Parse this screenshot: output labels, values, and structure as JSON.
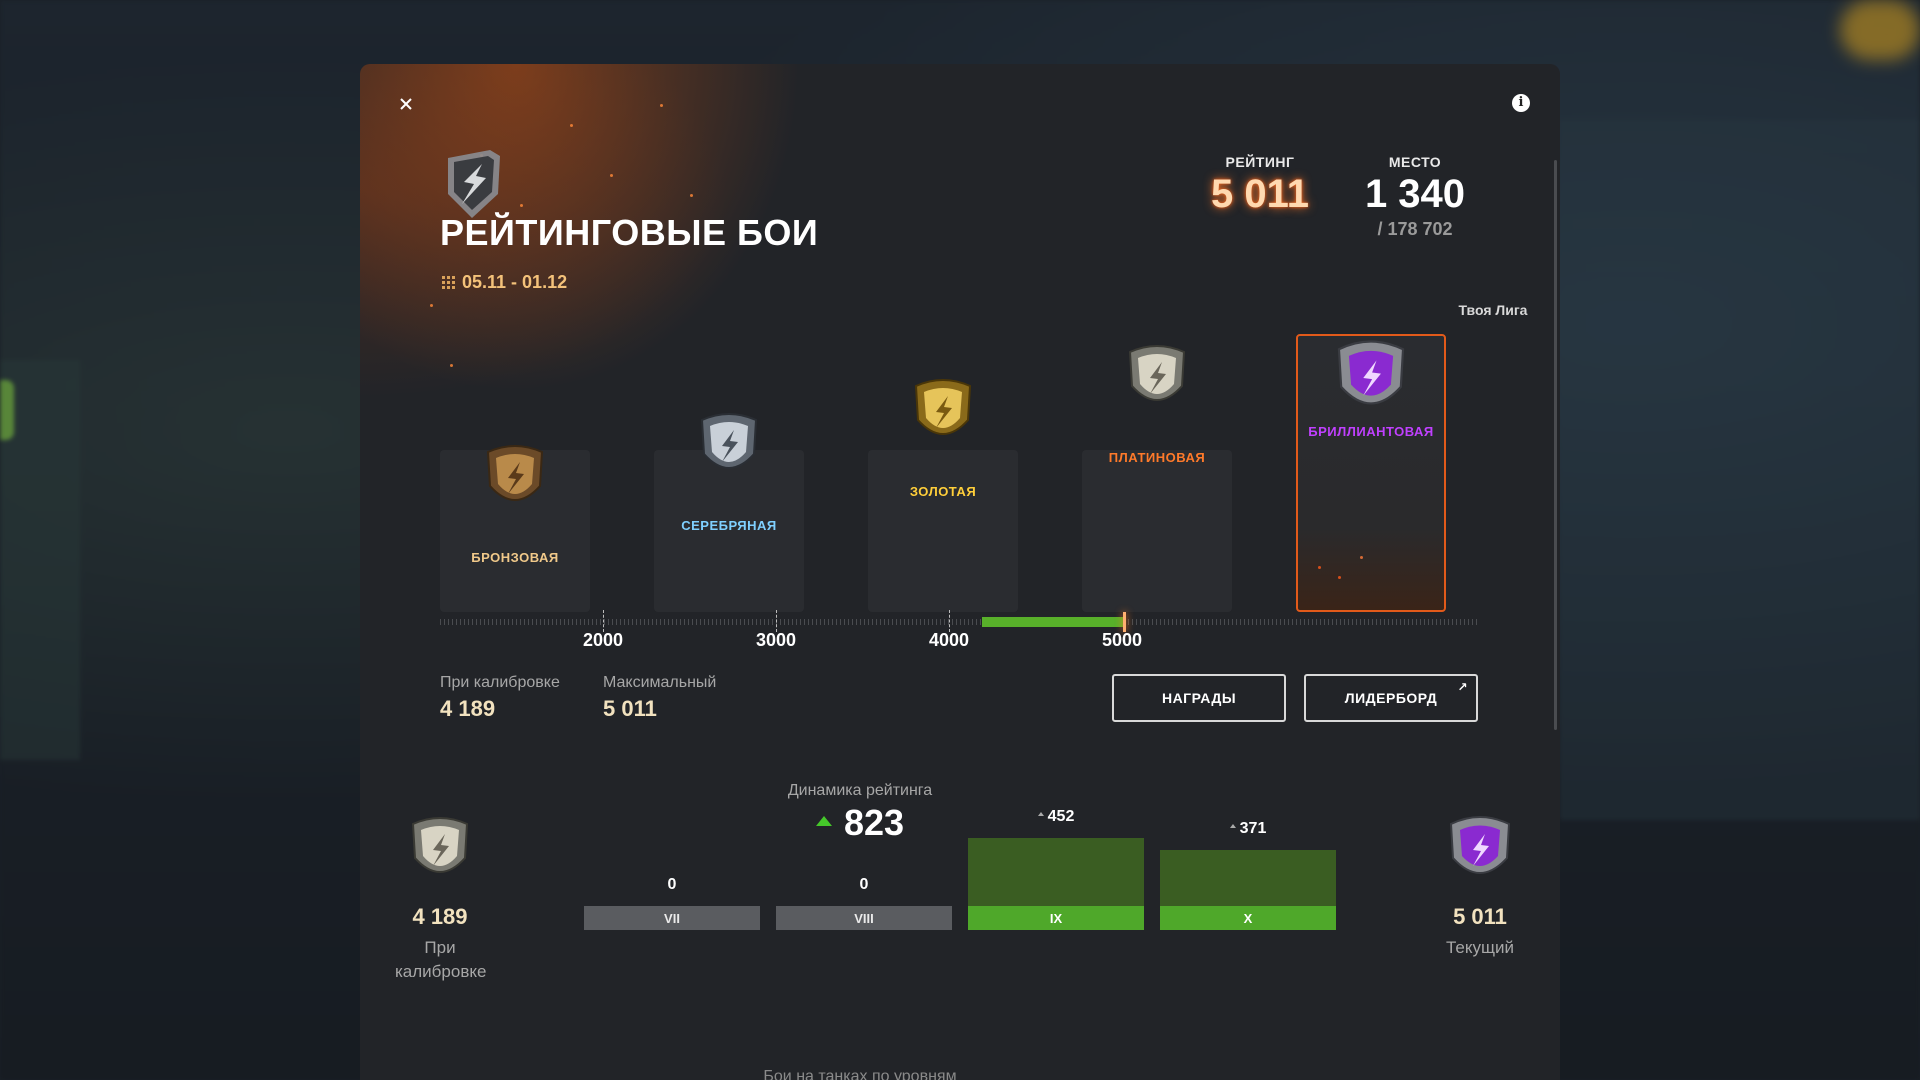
{
  "header": {
    "title": "РЕЙТИНГОВЫЕ БОИ",
    "dates": "05.11 - 01.12"
  },
  "stats": {
    "rating_label": "РЕЙТИНГ",
    "rating_value": "5 011",
    "place_label": "МЕСТО",
    "place_value": "1 340",
    "place_total": "/ 178 702"
  },
  "leagues": {
    "your_league_label": "Твоя Лига",
    "items": [
      {
        "name": "БРОНЗОВАЯ",
        "color": "#f0c98a"
      },
      {
        "name": "СЕРЕБРЯНАЯ",
        "color": "#7fd0ff"
      },
      {
        "name": "ЗОЛОТАЯ",
        "color": "#ffcf3a"
      },
      {
        "name": "ПЛАТИНОВАЯ",
        "color": "#ff7a2a"
      },
      {
        "name": "БРИЛЛИАНТОВАЯ",
        "color": "#c040ff"
      }
    ]
  },
  "scale": {
    "labels": [
      "2000",
      "3000",
      "4000",
      "5000"
    ],
    "current": 5011,
    "calibration": 4189
  },
  "metrics": {
    "calibration_label": "При калибровке",
    "calibration_value": "4 189",
    "max_label": "Максимальный",
    "max_value": "5 011"
  },
  "buttons": {
    "rewards": "НАГРАДЫ",
    "leaderboard": "ЛИДЕРБОРД"
  },
  "dynamics": {
    "title": "Динамика рейтинга",
    "value": "823",
    "start_value": "4 189",
    "start_label": "При калибровке",
    "end_value": "5 011",
    "end_label": "Текущий",
    "tiers": [
      {
        "tier": "VII",
        "value": "0",
        "delta": 0
      },
      {
        "tier": "VIII",
        "value": "0",
        "delta": 0
      },
      {
        "tier": "IX",
        "value": "452",
        "delta": 452
      },
      {
        "tier": "X",
        "value": "371",
        "delta": 371
      }
    ]
  },
  "footer": {
    "caption": "Бои на танках по уровням"
  },
  "colors": {
    "accent_green": "#4fa82a",
    "accent_orange": "#e25a1a",
    "gold_text": "#f2e2bf"
  }
}
